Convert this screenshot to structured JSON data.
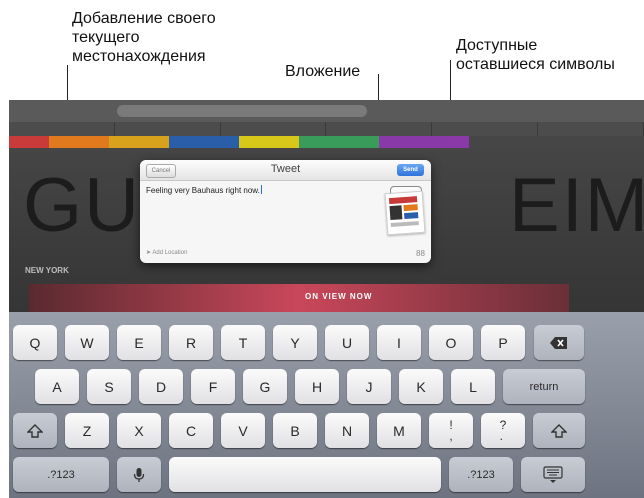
{
  "callouts": {
    "location": "Добавление своего\nтекущего\nместонахождения",
    "attachment": "Вложение",
    "remaining_chars": "Доступные\nоставшиеся символы"
  },
  "webpage": {
    "big_word_left": "GU",
    "big_word_right": "EIM",
    "section_heading": "NEW YORK",
    "hero_label": "ON VIEW NOW"
  },
  "tweet_sheet": {
    "cancel_label": "Cancel",
    "title": "Tweet",
    "send_label": "Send",
    "text": "Feeling very Bauhaus right now.",
    "add_location_label": "Add Location",
    "remaining_count": "88"
  },
  "keyboard": {
    "row1": [
      "Q",
      "W",
      "E",
      "R",
      "T",
      "Y",
      "U",
      "I",
      "O",
      "P"
    ],
    "row2": [
      "A",
      "S",
      "D",
      "F",
      "G",
      "H",
      "J",
      "K",
      "L"
    ],
    "return_label": "return",
    "row3": [
      "Z",
      "X",
      "C",
      "V",
      "B",
      "N",
      "M"
    ],
    "punct1_top": "!",
    "punct1_bottom": ",",
    "punct2_top": "?",
    "punct2_bottom": ".",
    "numbers_label_left": ".?123",
    "numbers_label_right": ".?123"
  },
  "colors": {
    "send_button": "#2f74dc",
    "keyboard_bg": "#7c828e",
    "key_face": "#f4f4f6"
  }
}
